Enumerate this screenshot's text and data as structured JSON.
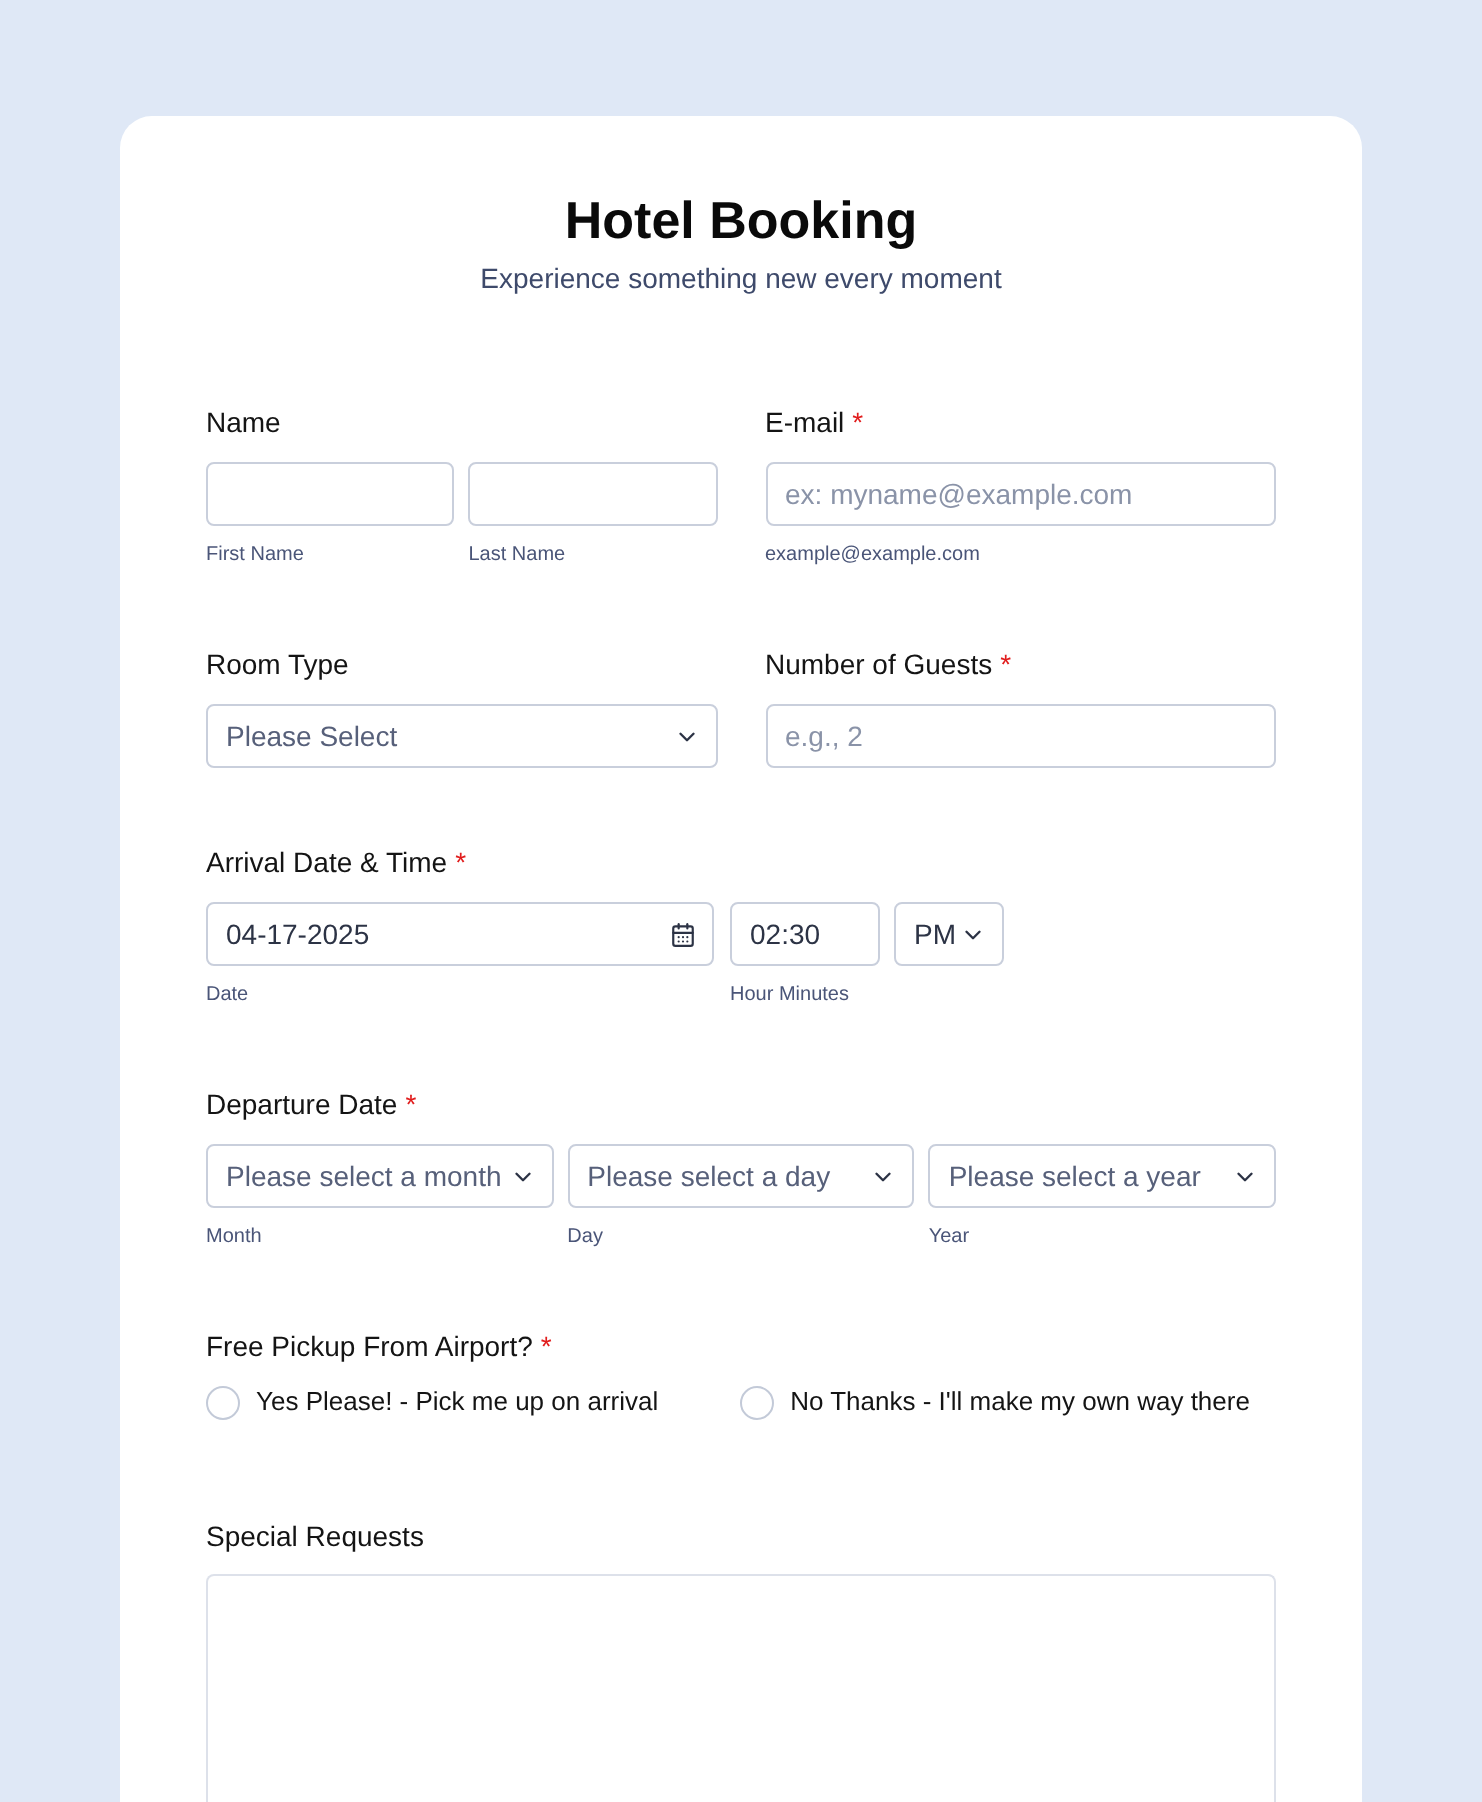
{
  "header": {
    "title": "Hotel Booking",
    "subtitle": "Experience something new every moment"
  },
  "rows": [
    {
      "fields": [
        {
          "kind": "name",
          "label": "Name",
          "inputs": [
            {
              "sublabel": "First Name"
            },
            {
              "sublabel": "Last Name"
            }
          ]
        },
        {
          "kind": "text",
          "label": "E-mail",
          "required_mark": "*",
          "placeholder": "ex: myname@example.com",
          "sublabel": "example@example.com"
        }
      ]
    },
    {
      "fields": [
        {
          "kind": "select",
          "label": "Room Type",
          "placeholder": "Please Select"
        },
        {
          "kind": "text",
          "label": "Number of Guests",
          "required_mark": "*",
          "placeholder": "e.g., 2"
        }
      ]
    },
    {
      "fields": [
        {
          "kind": "datetime",
          "label": "Arrival Date & Time",
          "required_mark": "*",
          "date": {
            "value": "04-17-2025",
            "sublabel": "Date"
          },
          "time": {
            "value": "02:30",
            "sublabel": "Hour Minutes"
          },
          "period": {
            "value": "PM"
          }
        }
      ]
    },
    {
      "fields": [
        {
          "kind": "date_selects",
          "label": "Departure Date",
          "required_mark": "*",
          "selects": [
            {
              "placeholder": "Please select a month",
              "sublabel": "Month"
            },
            {
              "placeholder": "Please select a day",
              "sublabel": "Day"
            },
            {
              "placeholder": "Please select a year",
              "sublabel": "Year"
            }
          ]
        }
      ]
    },
    {
      "fields": [
        {
          "kind": "radio",
          "label": "Free Pickup From Airport?",
          "required_mark": "*",
          "options": [
            {
              "label": "Yes Please! - Pick me up on arrival",
              "selected": false
            },
            {
              "label": "No Thanks - I'll make my own way there",
              "selected": false
            }
          ]
        }
      ]
    },
    {
      "fields": [
        {
          "kind": "textarea",
          "label": "Special Requests"
        }
      ]
    }
  ]
}
